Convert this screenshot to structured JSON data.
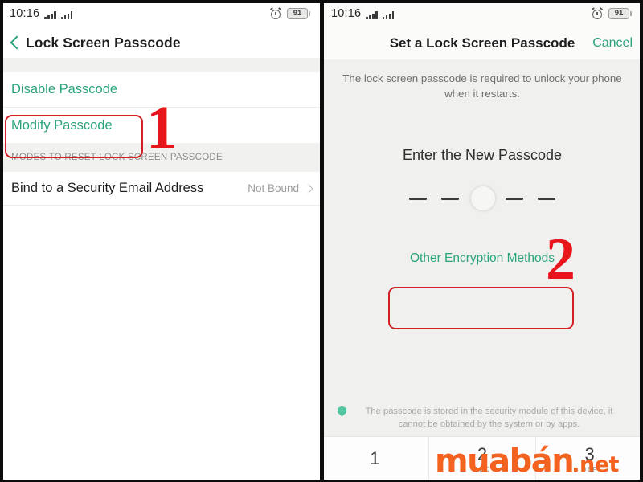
{
  "left_panel": {
    "status_bar": {
      "time": "10:16",
      "battery_level": "91",
      "alarm_icon": "alarm-clock-icon",
      "signal_icon": "signal-bars-icon"
    },
    "nav": {
      "back_icon": "back-chevron-icon",
      "title": "Lock Screen Passcode"
    },
    "options": [
      {
        "label": "Disable Passcode"
      },
      {
        "label": "Modify Passcode"
      }
    ],
    "section_header": "MODES TO RESET LOCK SCREEN PASSCODE",
    "bind_row": {
      "label": "Bind to a Security Email Address",
      "value": "Not Bound",
      "chevron_icon": "chevron-right-icon"
    }
  },
  "right_panel": {
    "status_bar": {
      "time": "10:16",
      "battery_level": "91",
      "alarm_icon": "alarm-clock-icon",
      "signal_icon": "signal-bars-icon"
    },
    "nav": {
      "title": "Set a Lock Screen Passcode",
      "cancel_label": "Cancel"
    },
    "hint": "The lock screen passcode is required to unlock your phone when it restarts.",
    "enter_title": "Enter the New Passcode",
    "passcode": {
      "length": 5,
      "entered": 0,
      "cursor_index": 3
    },
    "other_methods_label": "Other Encryption Methods",
    "security_note": {
      "icon": "shield-icon",
      "text": "The passcode is stored in the security module of this device, it cannot be obtained by the system or by apps."
    },
    "keypad": [
      {
        "num": "1",
        "sub": ""
      },
      {
        "num": "2",
        "sub": "ABC"
      },
      {
        "num": "3",
        "sub": "DEF"
      }
    ]
  },
  "annotations": {
    "step_one": "1",
    "step_two": "2",
    "highlight_color": "#d41f26"
  },
  "watermark": {
    "part1": "muabán",
    "part2": ".net",
    "color": "#f4621f"
  }
}
